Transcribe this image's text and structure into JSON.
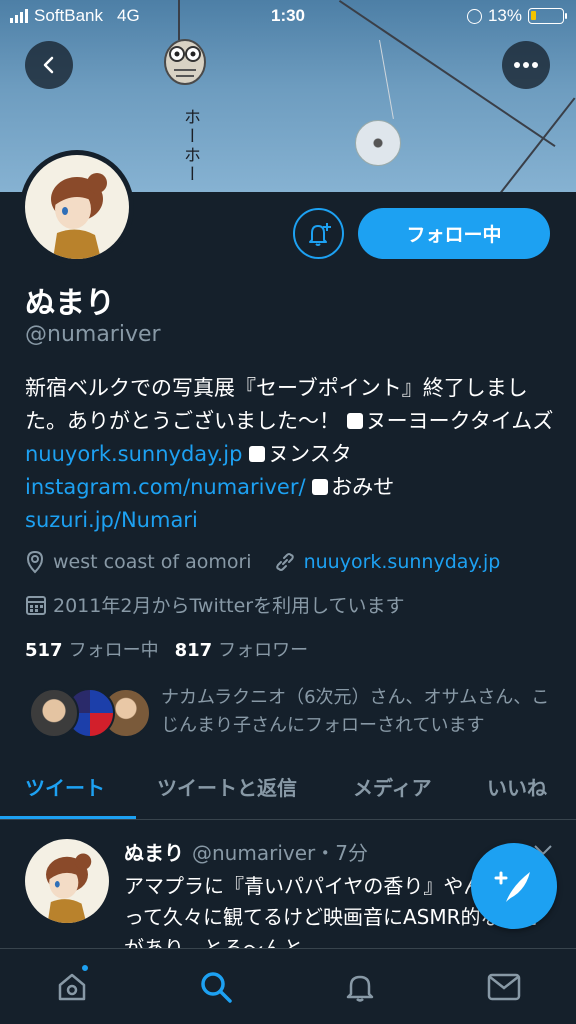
{
  "status_bar": {
    "carrier": "SoftBank",
    "network": "4G",
    "time": "1:30",
    "battery": "13%"
  },
  "banner": {
    "sign_text": "ホーホー"
  },
  "profile": {
    "display_name": "ぬまり",
    "handle": "@numariver",
    "follow_button": "フォロー中",
    "bio": {
      "text1": "新宿ベルクでの写真展『セーブポイント』終了しました。ありがとうございました〜！ ",
      "text2": "ヌーヨークタイムズ ",
      "link1": "nuuyork.sunnyday.jp",
      "text3": " ",
      "text4": "ヌンスタ ",
      "link2": "instagram.com/numariver/",
      "text5": " ",
      "text6": "おみせ ",
      "link3": "suzuri.jp/Numari"
    },
    "location": "west coast of aomori",
    "website": "nuuyork.sunnyday.jp",
    "joined": "2011年2月からTwitterを利用しています",
    "following_count": "517",
    "following_label": "フォロー中",
    "followers_count": "817",
    "followers_label": "フォロワー",
    "known_followers": "ナカムラクニオ（6次元）さん、オサムさん、こじんまり子さんにフォローされています"
  },
  "tabs": [
    {
      "label": "ツイート",
      "active": true
    },
    {
      "label": "ツイートと返信",
      "active": false
    },
    {
      "label": "メディア",
      "active": false
    },
    {
      "label": "いいね",
      "active": false
    }
  ],
  "tweet": {
    "name": "ぬまり",
    "handle_time": "@numariver・7分",
    "body": "アマプラに『青いパパイヤの香り』やん！と思って久々に観てるけど映画音にASMR的な良さがあり、とる〜んと"
  },
  "colors": {
    "accent": "#1da1f2",
    "background": "#15202b",
    "secondary_text": "#8899a6",
    "battery_low": "#f5c400"
  },
  "icons": [
    "back-icon",
    "more-icon",
    "bell-plus-icon",
    "location-icon",
    "link-icon",
    "calendar-icon",
    "compose-icon",
    "home-icon",
    "search-icon",
    "notifications-icon",
    "messages-icon"
  ]
}
